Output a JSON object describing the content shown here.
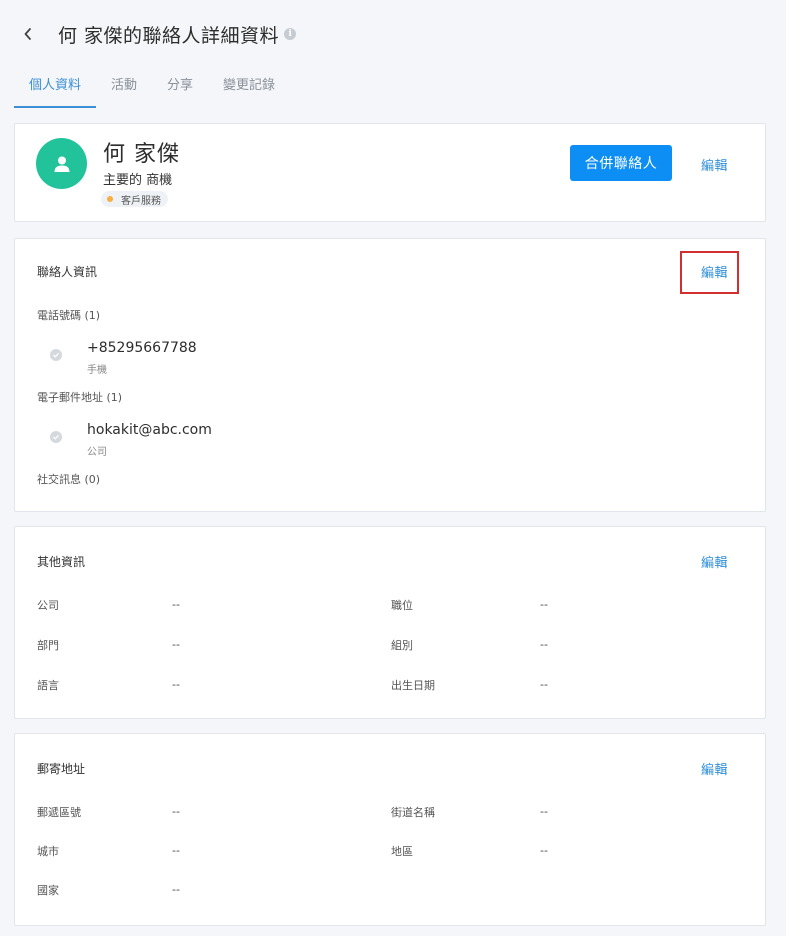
{
  "header": {
    "title": "何 家傑的聯絡人詳細資料"
  },
  "tabs": [
    {
      "label": "個人資料",
      "active": true
    },
    {
      "label": "活動",
      "active": false
    },
    {
      "label": "分享",
      "active": false
    },
    {
      "label": "變更記錄",
      "active": false
    }
  ],
  "profile": {
    "name": "何 家傑",
    "subtitle": "主要的 商機",
    "tag": "客戶服務",
    "tag_color": "#f5b041",
    "avatar_color": "#22c39b",
    "merge_label": "合併聯絡人",
    "edit_label": "編輯"
  },
  "contact": {
    "title": "聯絡人資訊",
    "edit_label": "編輯",
    "phone_heading": "電話號碼 (1)",
    "phone_value": "+85295667788",
    "phone_type": "手機",
    "email_heading": "電子郵件地址 (1)",
    "email_value": "hokakit@abc.com",
    "email_type": "公司",
    "social_heading": "社交訊息 (0)"
  },
  "other": {
    "title": "其他資訊",
    "edit_label": "編輯",
    "fields": [
      {
        "label": "公司",
        "value": "--"
      },
      {
        "label": "職位",
        "value": "--"
      },
      {
        "label": "部門",
        "value": "--"
      },
      {
        "label": "組別",
        "value": "--"
      },
      {
        "label": "語言",
        "value": "--"
      },
      {
        "label": "出生日期",
        "value": "--"
      }
    ]
  },
  "address": {
    "title": "郵寄地址",
    "edit_label": "編輯",
    "fields": [
      {
        "label": "郵遞區號",
        "value": "--"
      },
      {
        "label": "街道名稱",
        "value": "--"
      },
      {
        "label": "城市",
        "value": "--"
      },
      {
        "label": "地區",
        "value": "--"
      },
      {
        "label": "國家",
        "value": "--"
      }
    ]
  },
  "colors": {
    "accent": "#0c8ef5",
    "link": "#2f8fd8",
    "highlight": "#d32f2f"
  }
}
